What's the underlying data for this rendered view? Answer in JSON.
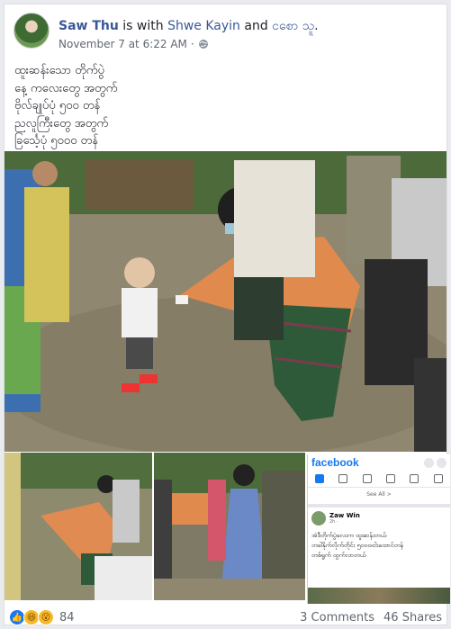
{
  "post": {
    "author": "Saw Thu",
    "tag_prefix": "is with",
    "tagged_1": "Shwe Kayin",
    "tag_and": "and",
    "tagged_2": "ငစော သူ",
    "tag_end": ".",
    "timestamp": "November 7 at 6:22 AM",
    "timestamp_sep": "·",
    "privacy_icon": "globe-icon",
    "text_lines": [
      "ထူးဆန်းသော တိုက်ပွဲ",
      "နေ့ ကလေးတွေ အတွက်",
      "ဗိုလ်ချုပ်ပုံ ၅၀၀ တန်",
      "ညလူကြီးတွေ အတွက်",
      "ခြင်္သေ့ပုံ ၅၀၀၀ တန်"
    ]
  },
  "embedded_screenshot": {
    "logo": "facebook",
    "see_all": "See All >",
    "author": "Zaw Win",
    "time": "2h · ",
    "body_lines": [
      "အဲဒီတိုက်ပွဲလေးက ထူးဆန်းတယ်",
      "တခါနိုက်လိုက်တိုင်း ၅၀၀၀၊ငါးထောင်တန်",
      "တစ်ရွက် ထွက်လာတယ်"
    ]
  },
  "footer": {
    "reaction_icons": [
      "like-icon",
      "haha-icon",
      "wow-icon"
    ],
    "reaction_count": "84",
    "comments": "3 Comments",
    "shares": "46 Shares"
  },
  "colors": {
    "link": "#385898",
    "fb_blue": "#1877f2",
    "meta_gray": "#616770"
  }
}
